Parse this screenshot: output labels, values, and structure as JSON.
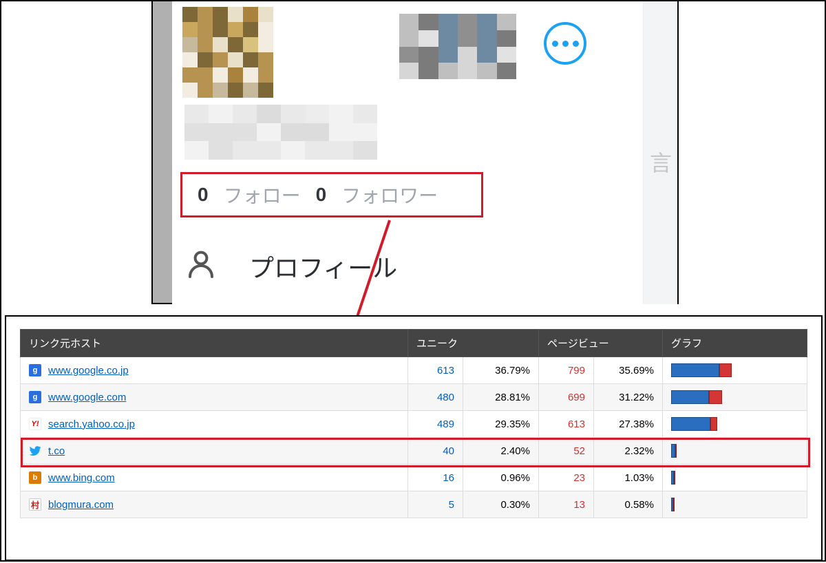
{
  "profile": {
    "follow_count": "0",
    "follow_label": "フォロー",
    "follower_count": "0",
    "follower_label": "フォロワー",
    "profile_label": "プロフィール",
    "sidebar_glyph": "言"
  },
  "table": {
    "headers": {
      "host": "リンク元ホスト",
      "unique": "ユニーク",
      "pageview": "ページビュー",
      "graph": "グラフ"
    },
    "rows": [
      {
        "icon": "g",
        "host": "www.google.co.jp",
        "unique": "613",
        "unique_pct": "36.79%",
        "pv": "799",
        "pv_pct": "35.69%",
        "blue_w": 70,
        "red_w": 18
      },
      {
        "icon": "g",
        "host": "www.google.com",
        "unique": "480",
        "unique_pct": "28.81%",
        "pv": "699",
        "pv_pct": "31.22%",
        "blue_w": 55,
        "red_w": 19
      },
      {
        "icon": "y",
        "host": "search.yahoo.co.jp",
        "unique": "489",
        "unique_pct": "29.35%",
        "pv": "613",
        "pv_pct": "27.38%",
        "blue_w": 57,
        "red_w": 10
      },
      {
        "icon": "t",
        "host": "t.co",
        "unique": "40",
        "unique_pct": "2.40%",
        "pv": "52",
        "pv_pct": "2.32%",
        "blue_w": 6,
        "red_w": 2
      },
      {
        "icon": "b",
        "host": "www.bing.com",
        "unique": "16",
        "unique_pct": "0.96%",
        "pv": "23",
        "pv_pct": "1.03%",
        "blue_w": 4,
        "red_w": 2
      },
      {
        "icon": "m",
        "host": "blogmura.com",
        "unique": "5",
        "unique_pct": "0.30%",
        "pv": "13",
        "pv_pct": "0.58%",
        "blue_w": 3,
        "red_w": 2
      }
    ],
    "highlight_index": 3
  }
}
